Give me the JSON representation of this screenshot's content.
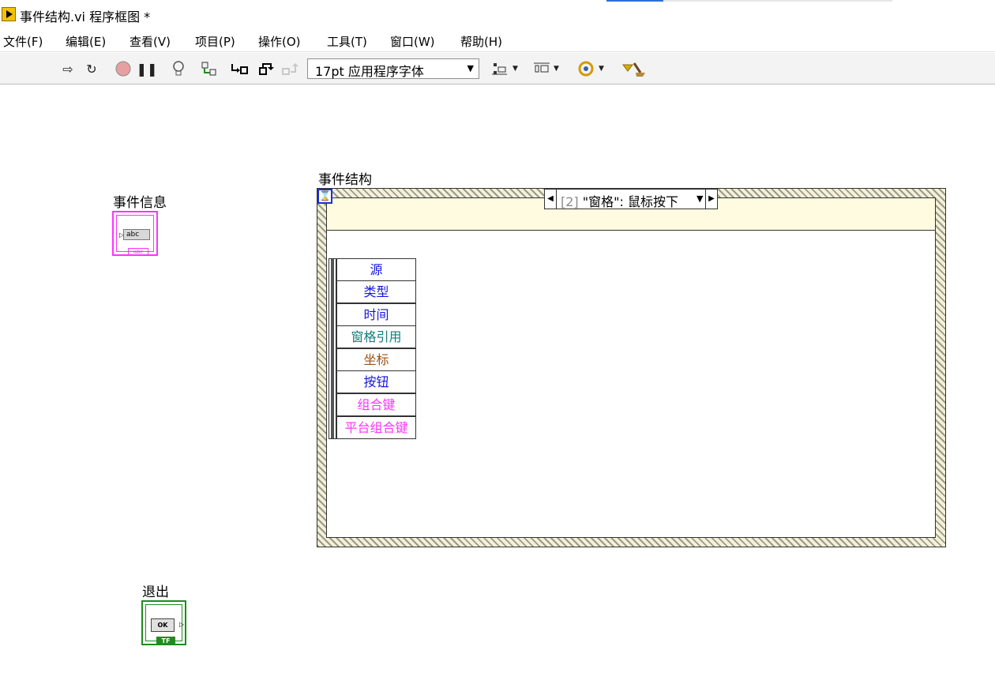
{
  "window": {
    "title": "事件结构.vi 程序框图 *"
  },
  "menu": [
    "文件(F)",
    "编辑(E)",
    "查看(V)",
    "项目(P)",
    "操作(O)",
    "工具(T)",
    "窗口(W)",
    "帮助(H)"
  ],
  "toolbar": {
    "font_select": "17pt 应用程序字体"
  },
  "diagram": {
    "event_info_label": "事件信息",
    "event_info_display": "abc",
    "event_info_type": "abc",
    "event_structure_label": "事件结构",
    "timeout_symbol": "⌛",
    "case_index": "[2]",
    "case_name": "\"窗格\": 鼠标按下",
    "event_data": [
      {
        "text": "源",
        "color": "#1515e0"
      },
      {
        "text": "类型",
        "color": "#1515e0"
      },
      {
        "text": "时间",
        "color": "#1515e0"
      },
      {
        "text": "窗格引用",
        "color": "#0f7f7a"
      },
      {
        "text": "坐标",
        "color": "#a0500f"
      },
      {
        "text": "按钮",
        "color": "#1515e0"
      },
      {
        "text": "组合键",
        "color": "#ff33ff"
      },
      {
        "text": "平台组合键",
        "color": "#ff33ff"
      }
    ],
    "exit_label": "退出",
    "exit_button_text": "OK",
    "exit_type": "TF"
  },
  "colors": {
    "string_wire": "#ff33ff",
    "boolean_wire": "#1e8c1e",
    "event_frame": "#f4f1d8"
  }
}
